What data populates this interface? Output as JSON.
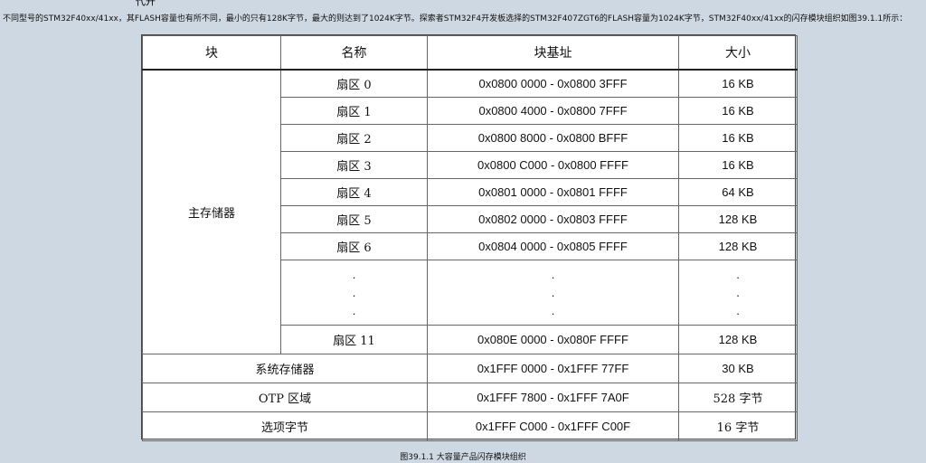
{
  "top_fragment": "代开",
  "intro_text": "不同型号的STM32F40xx/41xx，其FLASH容量也有所不同，最小的只有128K字节，最大的则达到了1024K字节。探索者STM32F4开发板选择的STM32F407ZGT6的FLASH容量为1024K字节，STM32F40xx/41xx的闪存模块组织如图39.1.1所示：",
  "table": {
    "headers": [
      "块",
      "名称",
      "块基址",
      "大小"
    ],
    "main_block": "主存储器",
    "sectors": [
      {
        "name": "扇区 0",
        "address": "0x0800 0000 - 0x0800 3FFF",
        "size": "16 KB"
      },
      {
        "name": "扇区 1",
        "address": "0x0800 4000 - 0x0800 7FFF",
        "size": "16 KB"
      },
      {
        "name": "扇区 2",
        "address": "0x0800 8000 - 0x0800 BFFF",
        "size": "16 KB"
      },
      {
        "name": "扇区 3",
        "address": "0x0800 C000 - 0x0800 FFFF",
        "size": "16 KB"
      },
      {
        "name": "扇区 4",
        "address": "0x0801 0000 - 0x0801 FFFF",
        "size": "64 KB"
      },
      {
        "name": "扇区 5",
        "address": "0x0802 0000 - 0x0803 FFFF",
        "size": "128 KB"
      },
      {
        "name": "扇区 6",
        "address": "0x0804 0000 - 0x0805 FFFF",
        "size": "128 KB"
      }
    ],
    "ellipsis": ".",
    "last_sector": {
      "name": "扇区 11",
      "address": "0x080E 0000 - 0x080F FFFF",
      "size": "128 KB"
    },
    "other_blocks": [
      {
        "name": "系统存储器",
        "address": "0x1FFF 0000 - 0x1FFF 77FF",
        "size": "30 KB"
      },
      {
        "name": "OTP 区域",
        "address": "0x1FFF 7800 - 0x1FFF 7A0F",
        "size": "528 字节"
      },
      {
        "name": "选项字节",
        "address": "0x1FFF C000 - 0x1FFF C00F",
        "size": "16 字节"
      }
    ]
  },
  "caption": "图39.1.1 大容量产品闪存模块组织"
}
